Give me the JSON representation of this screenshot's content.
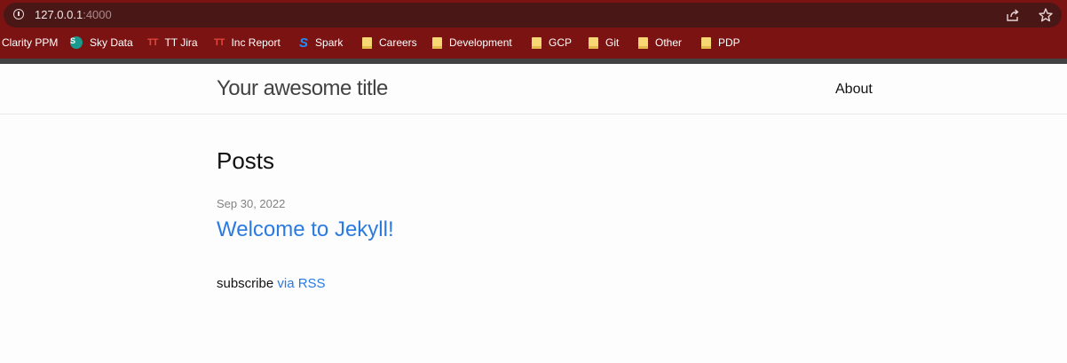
{
  "browser": {
    "url_host": "127.0.0.1",
    "url_port": ":4000",
    "bookmarks": [
      {
        "label": "Clarity PPM",
        "icon": "none"
      },
      {
        "label": "Sky Data",
        "icon": "sharepoint-icon"
      },
      {
        "label": "TT Jira",
        "icon": "tt-icon"
      },
      {
        "label": "Inc Report",
        "icon": "tt-icon"
      },
      {
        "label": "Spark",
        "icon": "spark-icon"
      },
      {
        "label": "Careers",
        "icon": "folder-icon"
      },
      {
        "label": "Development",
        "icon": "folder-icon"
      },
      {
        "label": "GCP",
        "icon": "folder-icon"
      },
      {
        "label": "Git",
        "icon": "folder-icon"
      },
      {
        "label": "Other",
        "icon": "folder-icon"
      },
      {
        "label": "PDP",
        "icon": "folder-icon"
      }
    ],
    "colors": {
      "chrome": "#7a1312",
      "omnibox": "#4a1717"
    }
  },
  "site": {
    "title": "Your awesome title",
    "nav": {
      "about": "About"
    }
  },
  "main": {
    "heading": "Posts",
    "posts": [
      {
        "date": "Sep 30, 2022",
        "title": "Welcome to Jekyll!"
      }
    ],
    "subscribe_text": "subscribe",
    "rss_link": "via RSS",
    "link_color": "#2a7ae2"
  }
}
